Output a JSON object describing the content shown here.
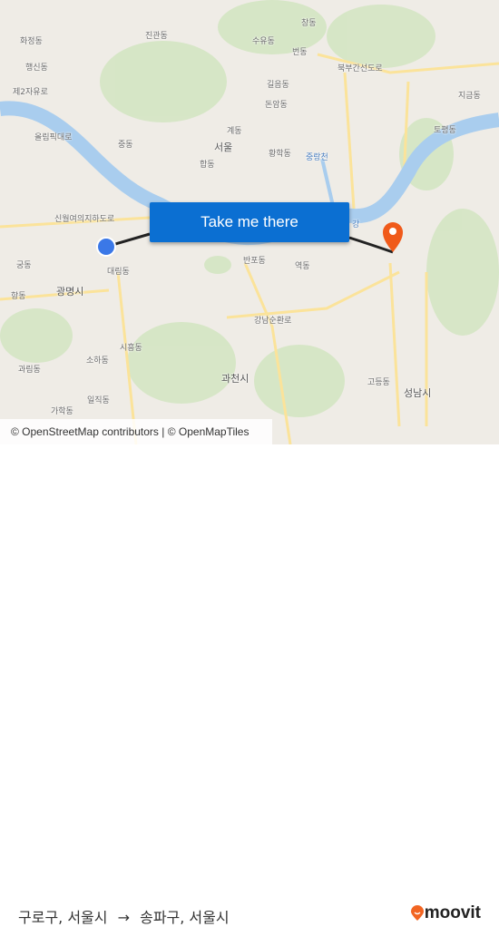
{
  "map": {
    "labels": [
      "화정동",
      "진관동",
      "창동",
      "수유동",
      "번동",
      "행신동",
      "북부간선도로",
      "제2자유로",
      "길음동",
      "돈암동",
      "지금동",
      "올림픽대로",
      "계동",
      "중동",
      "서울",
      "황학동",
      "토평동",
      "중랑천",
      "합동",
      "신월여의지하도로",
      "대림동",
      "반포동",
      "역동",
      "광명시",
      "궁동",
      "항동",
      "강남순환로",
      "시흥동",
      "소하동",
      "과천시",
      "과림동",
      "일직동",
      "고등동",
      "성남시",
      "가학동",
      "강"
    ],
    "attribution": "© OpenStreetMap contributors | © OpenMapTiles",
    "origin_color": "#3b78e7",
    "destination_color": "#f05a1a",
    "route_color": "#222222"
  },
  "cta": {
    "label": "Take me there",
    "color": "#0b6fd2"
  },
  "footer": {
    "origin": "구로구, 서울시",
    "arrow": "→",
    "destination": "송파구, 서울시",
    "logo_text": "moovit",
    "logo_color": "#f26522"
  }
}
